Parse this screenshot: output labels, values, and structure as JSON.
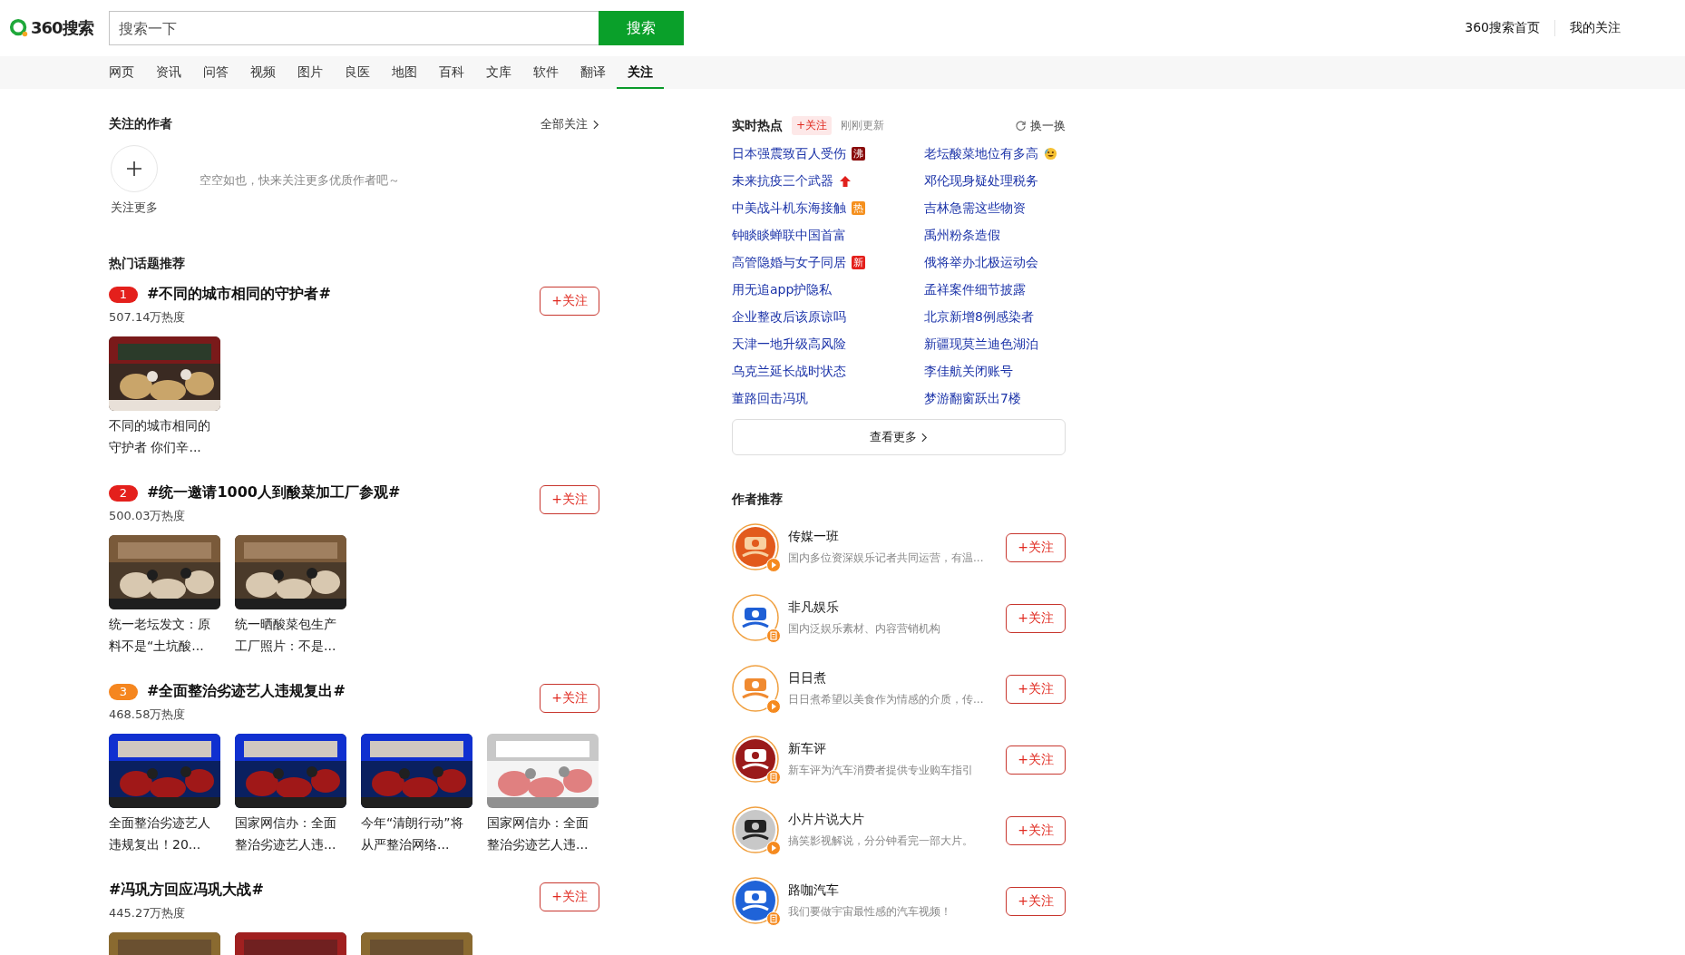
{
  "header": {
    "logo_text": "360搜索",
    "search": {
      "placeholder": "搜索一下"
    },
    "search_button": "搜索",
    "links": [
      "360搜索首页",
      "我的关注"
    ]
  },
  "nav": [
    {
      "label": "网页",
      "selected": false
    },
    {
      "label": "资讯",
      "selected": false
    },
    {
      "label": "问答",
      "selected": false
    },
    {
      "label": "视频",
      "selected": false
    },
    {
      "label": "图片",
      "selected": false
    },
    {
      "label": "良医",
      "selected": false
    },
    {
      "label": "地图",
      "selected": false
    },
    {
      "label": "百科",
      "selected": false
    },
    {
      "label": "文库",
      "selected": false
    },
    {
      "label": "软件",
      "selected": false
    },
    {
      "label": "翻译",
      "selected": false
    },
    {
      "label": "关注",
      "selected": true
    }
  ],
  "followed_authors": {
    "title": "关注的作者",
    "all_link": "全部关注",
    "add_label": "关注更多",
    "empty_text": "空空如也，快来关注更多优质作者吧～"
  },
  "hot_topics": {
    "title": "热门话题推荐",
    "topics": [
      {
        "rank": "1",
        "color": "#e4201c",
        "title": "#不同的城市相同的守护者#",
        "heat": "507.14万热度",
        "follow": "+关注",
        "items": [
          {
            "kind": "picture",
            "caption": "不同的城市相同的守护者 你们辛..."
          }
        ]
      },
      {
        "rank": "2",
        "color": "#e4201c",
        "title": "#统一邀请1000人到酸菜加工厂参观#",
        "heat": "500.03万热度",
        "follow": "+关注",
        "items": [
          {
            "kind": "picture",
            "caption": "统一老坛发文：原料不是“土坑酸..."
          },
          {
            "kind": "picture",
            "caption": "统一晒酸菜包生产工厂照片：不是..."
          }
        ]
      },
      {
        "rank": "3",
        "color": "#f5861f",
        "title": "#全面整治劣迹艺人违规复出#",
        "heat": "468.58万热度",
        "follow": "+关注",
        "items": [
          {
            "kind": "picture",
            "caption": "全面整治劣迹艺人违规复出！20..."
          },
          {
            "kind": "picture",
            "caption": "国家网信办：全面整治劣迹艺人违..."
          },
          {
            "kind": "picture",
            "caption": "今年“清朗行动”将从严整治网络..."
          },
          {
            "kind": "picture",
            "caption": "国家网信办：全面整治劣迹艺人违..."
          }
        ]
      },
      {
        "title": "#冯巩方回应冯巩大战#",
        "heat": "445.27万热度",
        "follow": "+关注"
      }
    ]
  },
  "realtime": {
    "title": "实时热点",
    "follow": "+关注",
    "updated": "刚刚更新",
    "refresh": "换一换",
    "more": "查看更多",
    "items": [
      {
        "text": "日本强震致百人受伤",
        "tag": {
          "text": "沸",
          "kind": "boil"
        }
      },
      {
        "text": "老坛酸菜地位有多高",
        "kind": "emoji"
      },
      {
        "text": "未来抗疫三个武器",
        "kind": "rising"
      },
      {
        "text": "邓伦现身疑处理税务"
      },
      {
        "text": "中美战斗机东海接触",
        "tag": {
          "text": "热",
          "kind": "hot"
        }
      },
      {
        "text": "吉林急需这些物资"
      },
      {
        "text": "钟睒睒蝉联中国首富"
      },
      {
        "text": "禹州粉条造假"
      },
      {
        "text": "高管隐婚与女子同居",
        "tag": {
          "text": "新",
          "kind": "new"
        }
      },
      {
        "text": "俄将举办北极运动会"
      },
      {
        "text": "用无追app护隐私"
      },
      {
        "text": "孟祥案件细节披露"
      },
      {
        "text": "企业整改后该原谅吗"
      },
      {
        "text": "北京新增8例感染者"
      },
      {
        "text": "天津一地升级高风险"
      },
      {
        "text": "新疆现莫兰迪色湖泊"
      },
      {
        "text": "乌克兰延长战时状态"
      },
      {
        "text": "李佳航关闭账号"
      },
      {
        "text": "董路回击冯巩"
      },
      {
        "text": "梦游翻窗跃出7楼"
      }
    ]
  },
  "author_recs": {
    "title": "作者推荐",
    "authors": [
      {
        "name": "传媒一班",
        "desc": "国内多位资深娱乐记者共同运营，有温...",
        "kind": "video",
        "follow": "+关注"
      },
      {
        "name": "非凡娱乐",
        "desc": "国内泛娱乐素材、内容营销机构",
        "kind": "article",
        "follow": "+关注"
      },
      {
        "name": "日日煮",
        "desc": "日日煮希望以美食作为情感的介质，传...",
        "kind": "video",
        "follow": "+关注"
      },
      {
        "name": "新车评",
        "desc": "新车评为汽车消费者提供专业购车指引",
        "kind": "article",
        "follow": "+关注"
      },
      {
        "name": "小片片说大片",
        "desc": "搞笑影视解说，分分钟看完一部大片。",
        "kind": "video",
        "follow": "+关注"
      },
      {
        "name": "路咖汽车",
        "desc": "我们要做宇宙最性感的汽车视频！",
        "kind": "article",
        "follow": "+关注"
      }
    ]
  }
}
